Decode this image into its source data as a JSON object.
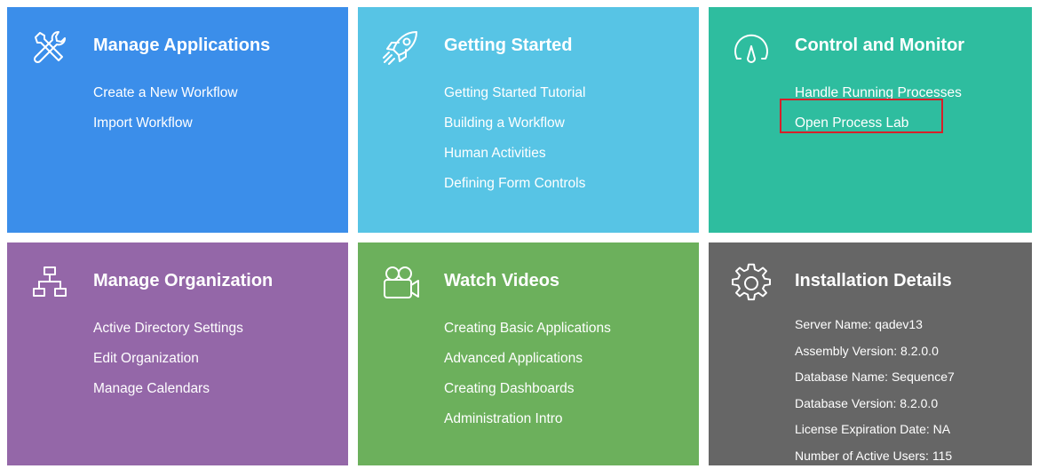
{
  "colors": {
    "manage_applications": "#3b8eea",
    "getting_started": "#57c4e5",
    "control_monitor": "#2ebd9f",
    "manage_organization": "#9467a8",
    "watch_videos": "#6cb05c",
    "installation_details": "#666666",
    "highlight": "#d6202a"
  },
  "tiles": [
    {
      "title": "Manage Applications",
      "icon": "tools-icon",
      "links": [
        "Create a New Workflow",
        "Import Workflow"
      ]
    },
    {
      "title": "Getting Started",
      "icon": "rocket-icon",
      "links": [
        "Getting Started Tutorial",
        "Building a Workflow",
        "Human Activities",
        "Defining Form Controls"
      ]
    },
    {
      "title": "Control and Monitor",
      "icon": "speedometer-icon",
      "links": [
        "Handle Running Processes",
        "Open Process Lab"
      ]
    },
    {
      "title": "Manage Organization",
      "icon": "org-chart-icon",
      "links": [
        "Active Directory Settings",
        "Edit Organization",
        "Manage Calendars"
      ]
    },
    {
      "title": "Watch Videos",
      "icon": "video-camera-icon",
      "links": [
        "Creating Basic Applications",
        "Advanced Applications",
        "Creating Dashboards",
        "Administration Intro"
      ]
    },
    {
      "title": "Installation Details",
      "icon": "gear-icon",
      "details": [
        "Server Name: qadev13",
        "Assembly Version: 8.2.0.0",
        "Database Name: Sequence7",
        "Database Version: 8.2.0.0",
        "License Expiration Date: NA",
        "Number of Active Users: 115"
      ]
    }
  ]
}
